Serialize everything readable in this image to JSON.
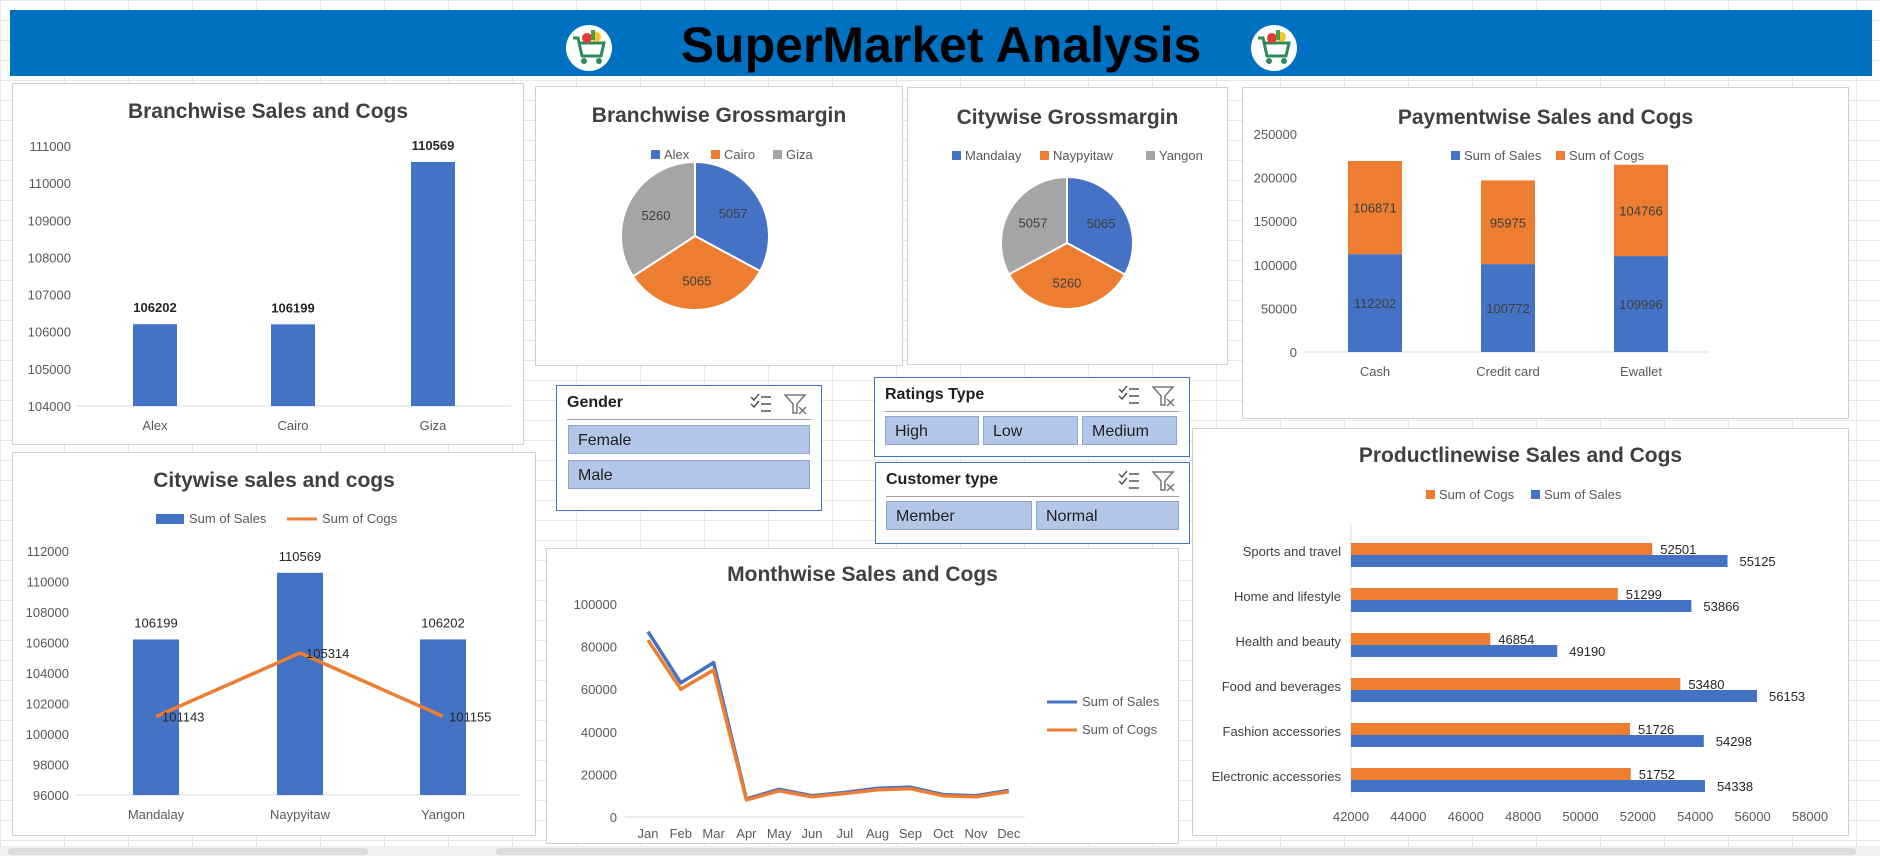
{
  "header": {
    "title": "SuperMarket Analysis"
  },
  "colors": {
    "blue": "#4472c4",
    "orange": "#ed7d31",
    "gray": "#a5a5a5",
    "banner": "#0070c0"
  },
  "slicers": {
    "gender": {
      "title": "Gender",
      "options": [
        "Female",
        "Male"
      ]
    },
    "ratings": {
      "title": "Ratings Type",
      "options": [
        "High",
        "Low",
        "Medium"
      ]
    },
    "customer": {
      "title": "Customer type",
      "options": [
        "Member",
        "Normal"
      ]
    }
  },
  "chart_data": [
    {
      "id": "branch_sales",
      "type": "bar",
      "title": "Branchwise Sales and Cogs",
      "categories": [
        "Alex",
        "Cairo",
        "Giza"
      ],
      "values": [
        106202,
        106199,
        110569
      ],
      "ylim": [
        104000,
        111000
      ],
      "yticks": [
        104000,
        105000,
        106000,
        107000,
        108000,
        109000,
        110000,
        111000
      ]
    },
    {
      "id": "branch_margin",
      "type": "pie",
      "title": "Branchwise Grossmargin",
      "labels": [
        "Alex",
        "Cairo",
        "Giza"
      ],
      "values": [
        5057,
        5065,
        5260
      ],
      "legend": "top"
    },
    {
      "id": "city_margin",
      "type": "pie",
      "title": "Citywise Grossmargin",
      "labels": [
        "Mandalay",
        "Naypyitaw",
        "Yangon"
      ],
      "values": [
        5065,
        5260,
        5057
      ],
      "legend": "top"
    },
    {
      "id": "payment",
      "type": "bar",
      "stacked": true,
      "title": "Paymentwise Sales and Cogs",
      "categories": [
        "Cash",
        "Credit card",
        "Ewallet"
      ],
      "series": [
        {
          "name": "Sum of Sales",
          "values": [
            112202,
            100772,
            109996
          ]
        },
        {
          "name": "Sum of Cogs",
          "values": [
            106871,
            95975,
            104766
          ]
        }
      ],
      "ylim": [
        0,
        250000
      ],
      "yticks": [
        0,
        50000,
        100000,
        150000,
        200000,
        250000
      ],
      "legend": "top"
    },
    {
      "id": "city_sales",
      "type": "bar",
      "title": "Citywise sales and cogs",
      "categories": [
        "Mandalay",
        "Naypyitaw",
        "Yangon"
      ],
      "series": [
        {
          "name": "Sum of Sales",
          "values": [
            106199,
            110569,
            106202
          ]
        },
        {
          "name": "Sum of Cogs",
          "values": [
            101143,
            105314,
            101155
          ]
        }
      ],
      "ylim": [
        96000,
        112000
      ],
      "yticks": [
        96000,
        98000,
        100000,
        102000,
        104000,
        106000,
        108000,
        110000,
        112000
      ],
      "legend": "top"
    },
    {
      "id": "month",
      "type": "line",
      "title": "Monthwise Sales and Cogs",
      "categories": [
        "Jan",
        "Feb",
        "Mar",
        "Apr",
        "May",
        "Jun",
        "Jul",
        "Aug",
        "Sep",
        "Oct",
        "Nov",
        "Dec"
      ],
      "series": [
        {
          "name": "Sum of Sales",
          "values": [
            87000,
            63000,
            72500,
            8500,
            13000,
            10000,
            11500,
            13500,
            14000,
            10500,
            10000,
            12500
          ]
        },
        {
          "name": "Sum of Cogs",
          "values": [
            83000,
            60000,
            69000,
            8000,
            12300,
            9500,
            11000,
            12800,
            13300,
            10000,
            9500,
            11900
          ]
        }
      ],
      "ylim": [
        0,
        100000
      ],
      "yticks": [
        0,
        20000,
        40000,
        60000,
        80000,
        100000
      ],
      "legend": "right"
    },
    {
      "id": "product",
      "type": "bar",
      "orientation": "horizontal",
      "title": "Productlinewise Sales and Cogs",
      "categories": [
        "Sports and travel",
        "Home and lifestyle",
        "Health and beauty",
        "Food and beverages",
        "Fashion accessories",
        "Electronic accessories"
      ],
      "series": [
        {
          "name": "Sum of Cogs",
          "values": [
            52501,
            51299,
            46854,
            53480,
            51726,
            51752
          ]
        },
        {
          "name": "Sum of Sales",
          "values": [
            55125,
            53866,
            49190,
            56153,
            54298,
            54338
          ]
        }
      ],
      "xlim": [
        42000,
        58000
      ],
      "xticks": [
        42000,
        44000,
        46000,
        48000,
        50000,
        52000,
        54000,
        56000,
        58000
      ],
      "legend": "top"
    }
  ]
}
